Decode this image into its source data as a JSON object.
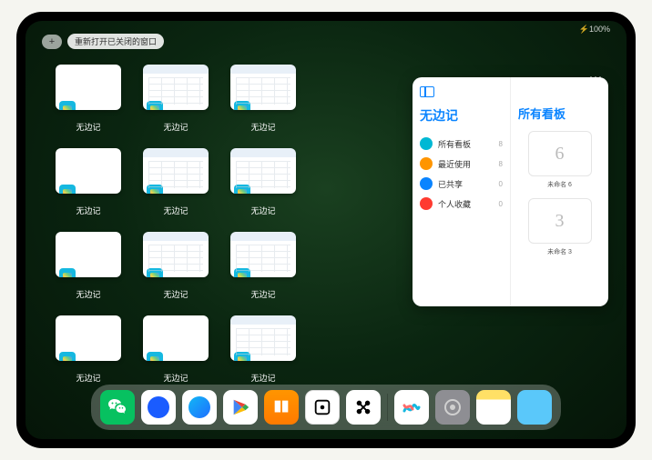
{
  "status": {
    "battery": "⚡100%"
  },
  "top": {
    "plus": "+",
    "reopen_label": "重新打开已关闭的窗口"
  },
  "grid": {
    "app_label": "无边记",
    "items": [
      {
        "content": false
      },
      {
        "content": true
      },
      {
        "content": true
      },
      null,
      {
        "content": false
      },
      {
        "content": true
      },
      {
        "content": true
      },
      null,
      {
        "content": false
      },
      {
        "content": true
      },
      {
        "content": true
      },
      null,
      {
        "content": false
      },
      {
        "content": false
      },
      {
        "content": true
      },
      null
    ]
  },
  "panel": {
    "more": "···",
    "left_title": "无边记",
    "items": [
      {
        "label": "所有看板",
        "count": "8",
        "color": "#00b8d4"
      },
      {
        "label": "最近使用",
        "count": "8",
        "color": "#ff9500"
      },
      {
        "label": "已共享",
        "count": "0",
        "color": "#0a84ff"
      },
      {
        "label": "个人收藏",
        "count": "0",
        "color": "#ff3b30"
      }
    ],
    "right_title": "所有看板",
    "boards": [
      {
        "glyph": "6",
        "name": "未命名 6"
      },
      {
        "glyph": "3",
        "name": "未命名 3"
      }
    ]
  },
  "dock": {
    "left": [
      {
        "name": "wechat",
        "cls": "di-wechat"
      },
      {
        "name": "blue-circle-app",
        "cls": "di-blue1"
      },
      {
        "name": "qq",
        "cls": "di-qq"
      },
      {
        "name": "play",
        "cls": "di-play"
      },
      {
        "name": "books",
        "cls": "di-books"
      },
      {
        "name": "dots",
        "cls": "di-dots"
      },
      {
        "name": "camo",
        "cls": "di-x"
      }
    ],
    "right": [
      {
        "name": "freeform",
        "cls": "di-freeform"
      },
      {
        "name": "settings",
        "cls": "di-settings"
      },
      {
        "name": "notes",
        "cls": "di-notes"
      },
      {
        "name": "app-library",
        "cls": "di-folder"
      }
    ]
  }
}
